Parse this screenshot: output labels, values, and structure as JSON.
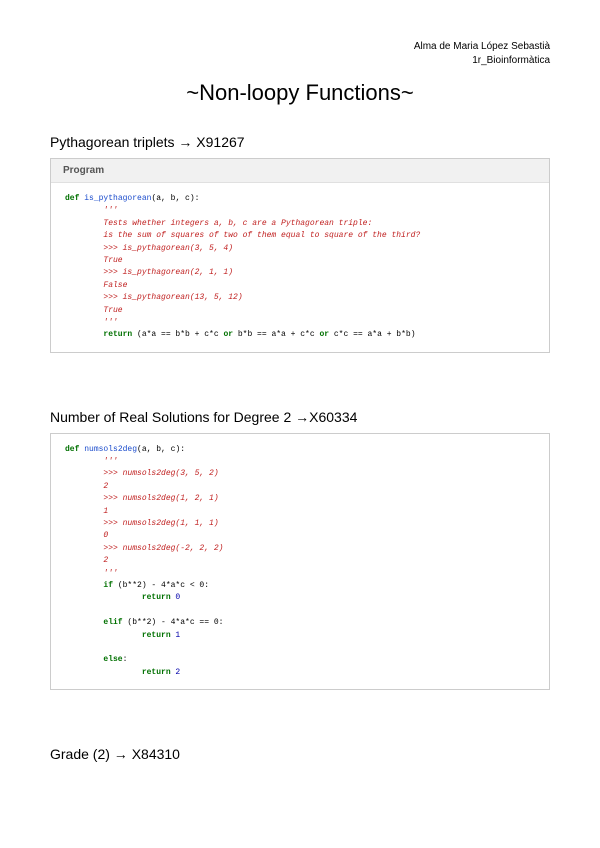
{
  "header": {
    "name": "Alma de Maria López Sebastià",
    "course": "1r_Bioinformàtica"
  },
  "title": "~Non-loopy Functions~",
  "sections": [
    {
      "label": "Pythagorean triplets → X91267"
    },
    {
      "label": "Number of Real Solutions for Degree 2 →X60334"
    },
    {
      "label": "Grade (2) → X84310"
    }
  ],
  "programs": {
    "box1_header": "Program",
    "pythagorean": {
      "kw_def": "def",
      "fn_name": "is_pythagorean",
      "params": "(a, b, c):",
      "doc_open": "'''",
      "doc_l1": "Tests whether integers a, b, c are a Pythagorean triple:",
      "doc_l2": "is the sum of squares of two of them equal to square of the third?",
      "doc_l3": ">>> is_pythagorean(3, 5, 4)",
      "doc_l4": "True",
      "doc_l5": ">>> is_pythagorean(2, 1, 1)",
      "doc_l6": "False",
      "doc_l7": ">>> is_pythagorean(13, 5, 12)",
      "doc_l8": "True",
      "doc_close": "'''",
      "kw_return": "return",
      "ret_body": " (a*a == b*b + c*c ",
      "kw_or1": "or",
      "ret_body2": " b*b == a*a + c*c ",
      "kw_or2": "or",
      "ret_body3": " c*c == a*a + b*b)"
    },
    "numsols": {
      "kw_def": "def",
      "fn_name": "numsols2deg",
      "params": "(a, b, c):",
      "doc_open": "'''",
      "doc_l1": ">>> numsols2deg(3, 5, 2)",
      "doc_l2": "2",
      "doc_l3": ">>> numsols2deg(1, 2, 1)",
      "doc_l4": "1",
      "doc_l5": ">>> numsols2deg(1, 1, 1)",
      "doc_l6": "0",
      "doc_l7": ">>> numsols2deg(-2, 2, 2)",
      "doc_l8": "2",
      "doc_close": "'''",
      "kw_if": "if",
      "cond1": " (b**2) - 4*a*c < 0:",
      "kw_return1": "return",
      "retv1": " 0",
      "kw_elif": "elif",
      "cond2": " (b**2) - 4*a*c == 0:",
      "kw_return2": "return",
      "retv2": " 1",
      "kw_else": "else",
      "colon": ":",
      "kw_return3": "return",
      "retv3": " 2"
    }
  }
}
